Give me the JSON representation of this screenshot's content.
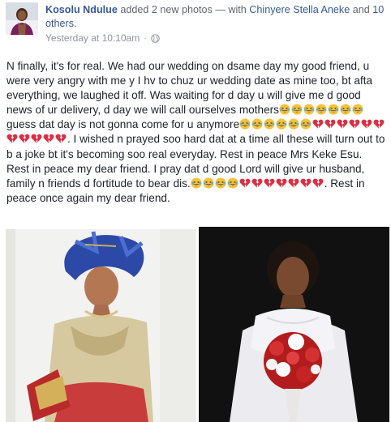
{
  "post": {
    "author": "Kosolu Ndulue",
    "action": "added 2 new photos",
    "with_prefix": "— with",
    "tagged_name": "Chinyere Stella Aneke",
    "conj": "and",
    "others": "10 others.",
    "timestamp": "Yesterday at 10:10am",
    "separator": "·",
    "privacy_icon": "globe-icon",
    "body_segments": {
      "s1": "N finally, it's for real. We had our wedding on dsame day my good friend, u were very angry with me y I hv to chuz ur wedding date as mine too, bt afta everything, we laughed it off. Was waiting for d day u will give me d good news of ur delivery, d day we will call ourselves mothers",
      "s2": "guess dat day is not gonna come for u anymore",
      "s3": ". I wished n prayed soo hard dat at a time all these will turn out to b a joke bt it's becoming soo real everyday. Rest in peace Mrs Keke Esu. Rest in peace my dear friend. I pray dat d good Lord will give ur husband, family n friends d fortitude to bear dis.",
      "s4": ". Rest in peace once again my dear friend."
    },
    "emoji_names": [
      "face-with-tears-of-joy-emoji",
      "broken-heart-emoji"
    ],
    "photos": [
      "photo-woman-blue-gele",
      "photo-bride-with-red-bouquet"
    ]
  },
  "colors": {
    "link": "#365899",
    "text": "#1d2129",
    "meta": "#90949c",
    "laugh": "#f5c33b",
    "heart": "#dd2e44"
  }
}
